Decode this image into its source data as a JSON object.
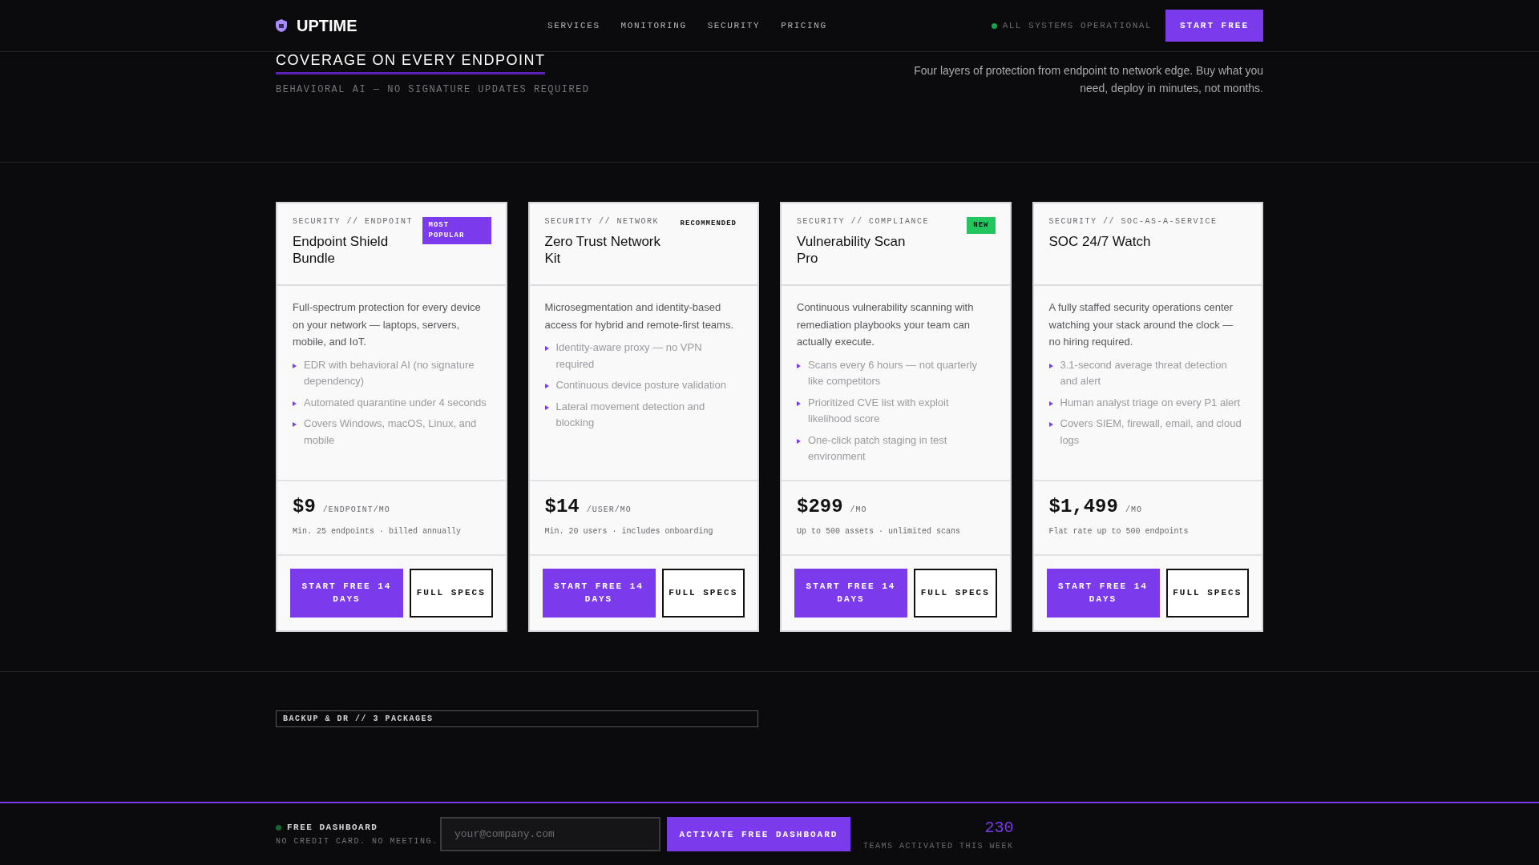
{
  "header": {
    "logo": "UPTIME",
    "nav": [
      "SERVICES",
      "MONITORING",
      "SECURITY",
      "PRICING"
    ],
    "status": {
      "text": "ALL SYSTEMS OPERATIONAL"
    },
    "cta": "START FREE"
  },
  "intro": {
    "title": "COVERAGE ON EVERY ENDPOINT",
    "subtitle": "BEHAVIORAL AI — NO SIGNATURE UPDATES REQUIRED",
    "description": "Four layers of protection from endpoint to network edge. Buy what you need, deploy in minutes, not months."
  },
  "cards": [
    {
      "category": "SECURITY // ENDPOINT",
      "badge": {
        "text": "MOST POPULAR",
        "kind": "filled",
        "color": "#7c3aed"
      },
      "name": "Endpoint Shield Bundle",
      "description": "Full-spectrum protection for every device on your network — laptops, servers, mobile, and IoT.",
      "features": [
        "EDR with behavioral AI (no signature dependency)",
        "Automated quarantine under 4 seconds",
        "Covers Windows, macOS, Linux, and mobile"
      ],
      "price": "$9",
      "unit": "/ENDPOINT/MO",
      "terms": "Min. 25 endpoints · billed annually",
      "primary": "START FREE 14 DAYS",
      "secondary": "FULL SPECS"
    },
    {
      "category": "SECURITY // NETWORK",
      "badge": {
        "text": "RECOMMENDED",
        "kind": "plain"
      },
      "name": "Zero Trust Network Kit",
      "description": "Microsegmentation and identity-based access for hybrid and remote-first teams.",
      "features": [
        "Identity-aware proxy — no VPN required",
        "Continuous device posture validation",
        "Lateral movement detection and blocking"
      ],
      "price": "$14",
      "unit": "/USER/MO",
      "terms": "Min. 20 users · includes onboarding",
      "primary": "START FREE 14 DAYS",
      "secondary": "FULL SPECS"
    },
    {
      "category": "SECURITY // COMPLIANCE",
      "badge": {
        "text": "NEW",
        "kind": "filled",
        "color": "#22c55e"
      },
      "name": "Vulnerability Scan Pro",
      "description": "Continuous vulnerability scanning with remediation playbooks your team can actually execute.",
      "features": [
        "Scans every 6 hours — not quarterly like competitors",
        "Prioritized CVE list with exploit likelihood score",
        "One-click patch staging in test environment"
      ],
      "price": "$299",
      "unit": "/MO",
      "terms": "Up to 500 assets · unlimited scans",
      "primary": "START FREE 14 DAYS",
      "secondary": "FULL SPECS"
    },
    {
      "category": "SECURITY // SOC-AS-A-SERVICE",
      "name": "SOC 24/7 Watch",
      "description": "A fully staffed security operations center watching your stack around the clock — no hiring required.",
      "features": [
        "3.1-second average threat detection and alert",
        "Human analyst triage on every P1 alert",
        "Covers SIEM, firewall, email, and cloud logs"
      ],
      "price": "$1,499",
      "unit": "/MO",
      "terms": "Flat rate up to 500 endpoints",
      "primary": "START FREE 14 DAYS",
      "secondary": "FULL SPECS"
    }
  ],
  "backup": {
    "tag": "BACKUP & DR // 3 PACKAGES"
  },
  "footer_bar": {
    "title": "FREE DASHBOARD",
    "note": "NO CREDIT CARD. NO MEETING.",
    "email": {
      "placeholder": "your@company.com"
    },
    "button": "ACTIVATE FREE DASHBOARD",
    "count": "230",
    "count_label": "TEAMS ACTIVATED THIS WEEK"
  }
}
